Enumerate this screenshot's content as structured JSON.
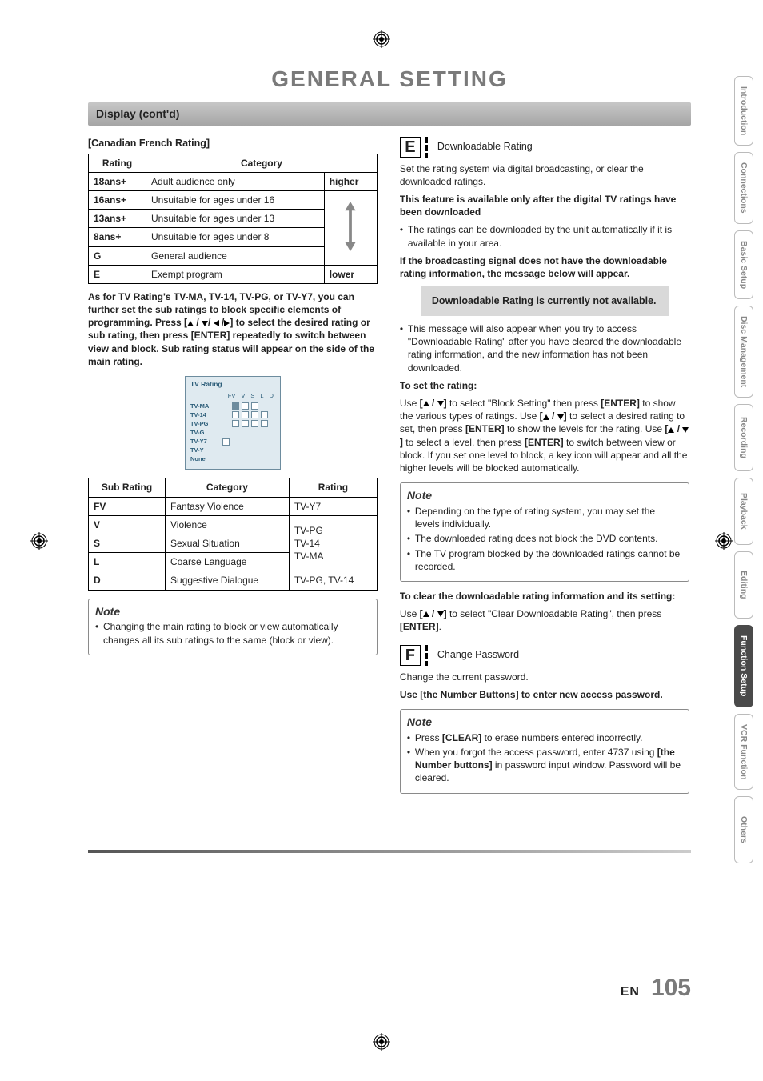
{
  "page_title": "GENERAL SETTING",
  "section_bar": "Display (cont'd)",
  "left": {
    "heading": "[Canadian French Rating]",
    "table1": {
      "headers": [
        "Rating",
        "Category"
      ],
      "rows": [
        [
          "18ans+",
          "Adult audience only"
        ],
        [
          "16ans+",
          "Unsuitable for ages under 16"
        ],
        [
          "13ans+",
          "Unsuitable for ages under 13"
        ],
        [
          "8ans+",
          "Unsuitable for ages under 8"
        ],
        [
          "G",
          "General audience"
        ],
        [
          "E",
          "Exempt program"
        ]
      ],
      "higher": "higher",
      "lower": "lower"
    },
    "paragraph1_prefix": "As for TV Rating's TV-MA, TV-14, TV-PG, or TV-Y7, you can further set the sub ratings to block specific elements of programming. Press [",
    "paragraph1_suffix": "] to select the desired rating or sub rating, then press [ENTER] repeatedly to switch between view and block. Sub rating status will appear on the side of the main rating.",
    "tv_box": {
      "title": "TV Rating",
      "cols": [
        "FV",
        "V",
        "S",
        "L",
        "D"
      ],
      "rows": [
        "TV-MA",
        "TV-14",
        "TV-PG",
        "TV-G",
        "TV-Y7",
        "TV-Y",
        "None"
      ]
    },
    "table2": {
      "headers": [
        "Sub Rating",
        "Category",
        "Rating"
      ],
      "rows": [
        [
          "FV",
          "Fantasy Violence",
          "TV-Y7"
        ],
        [
          "V",
          "Violence",
          ""
        ],
        [
          "S",
          "Sexual Situation",
          ""
        ],
        [
          "L",
          "Coarse Language",
          ""
        ],
        [
          "D",
          "Suggestive Dialogue",
          "TV-PG, TV-14"
        ]
      ],
      "merged_rating": "TV-PG\nTV-14\nTV-MA"
    },
    "note": {
      "title": "Note",
      "items": [
        "Changing the main rating to block or view automatically changes all its sub ratings to the same (block or view)."
      ]
    }
  },
  "right": {
    "e_label_letter": "E",
    "e_label_text": "Downloadable Rating",
    "e_para1": "Set the rating system via digital broadcasting, or clear the downloaded ratings.",
    "e_bold1": "This feature is available only after the digital TV ratings have been downloaded",
    "e_bullets1": [
      "The ratings can be downloaded by the unit automatically if it is available in your area."
    ],
    "e_bold2": "If the broadcasting signal does not have the downloadable rating information, the message below will appear.",
    "e_msg": "Downloadable Rating is currently not available.",
    "e_bullets2": [
      "This message will also appear when you try to access \"Downloadable Rating\" after you have cleared the downloadable rating information, and the new information has not been downloaded."
    ],
    "e_set_heading": "To set the rating:",
    "e_set_line1a": "Use ",
    "e_set_line1b": " to select \"Block Setting\" then press ",
    "e_set_line1c": " to show the various types of ratings. Use ",
    "e_set_line1d": " to select a desired rating to set, then press ",
    "e_set_line1e": " to show the levels for the rating. Use ",
    "e_set_line1f": " to select a level, then press ",
    "e_set_line1g": " to switch between view or block. If you set one level to block, a key icon will appear and all the higher levels will be blocked automatically.",
    "key_enter": "[ENTER]",
    "e_note": {
      "title": "Note",
      "items": [
        "Depending on the type of rating system, you may set the levels individually.",
        "The downloaded rating does not block the DVD contents.",
        "The TV program blocked by the downloaded ratings cannot be recorded."
      ]
    },
    "e_clear_heading": "To clear the downloadable rating information and its setting:",
    "e_clear_a": "Use ",
    "e_clear_b": " to select \"Clear Downloadable Rating\", then press ",
    "e_clear_c": ".",
    "f_label_letter": "F",
    "f_label_text": "Change Password",
    "f_para1": "Change the current password.",
    "f_bold1": "Use [the Number Buttons] to enter new access password.",
    "f_note": {
      "title": "Note",
      "items_html": [
        {
          "pre": "Press ",
          "key": "[CLEAR]",
          "post": " to erase numbers entered incorrectly."
        },
        {
          "pre": "When you forgot the access password, enter 4737 using ",
          "key": "[the Number buttons]",
          "post": " in password input window. Password will be cleared."
        }
      ]
    }
  },
  "tabs": [
    {
      "label": "Introduction",
      "active": false
    },
    {
      "label": "Connections",
      "active": false
    },
    {
      "label": "Basic Setup",
      "active": false
    },
    {
      "label": "Disc Management",
      "active": false,
      "twoline": true
    },
    {
      "label": "Recording",
      "active": false
    },
    {
      "label": "Playback",
      "active": false
    },
    {
      "label": "Editing",
      "active": false
    },
    {
      "label": "Function Setup",
      "active": true
    },
    {
      "label": "VCR Function",
      "active": false
    },
    {
      "label": "Others",
      "active": false
    }
  ],
  "page_number": {
    "prefix": "EN",
    "num": "105"
  }
}
